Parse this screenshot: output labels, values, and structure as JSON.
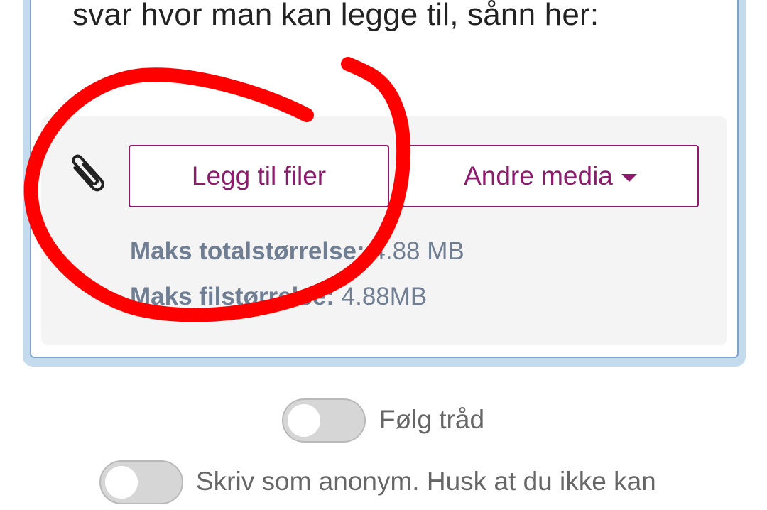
{
  "editor": {
    "text": "svar hvor man kan legge til, sånn her:"
  },
  "attachments": {
    "icon": "paperclip-icon",
    "add_files_label": "Legg til filer",
    "other_media_label": "Andre media",
    "max_total_label": "Maks totalstørrelse:",
    "max_total_value": "4.88 MB",
    "max_file_label": "Maks filstørrelse:",
    "max_file_value": "4.88MB"
  },
  "options": {
    "follow_thread_label": "Følg tråd",
    "follow_thread_on": false,
    "anonymous_label": "Skriv som anonym. Husk at du ikke kan",
    "anonymous_on": false
  },
  "colors": {
    "accent": "#8c1a6d",
    "focus_glow": "#c4dbee",
    "annotation": "#ff0000",
    "muted_text": "#6f7e92"
  }
}
